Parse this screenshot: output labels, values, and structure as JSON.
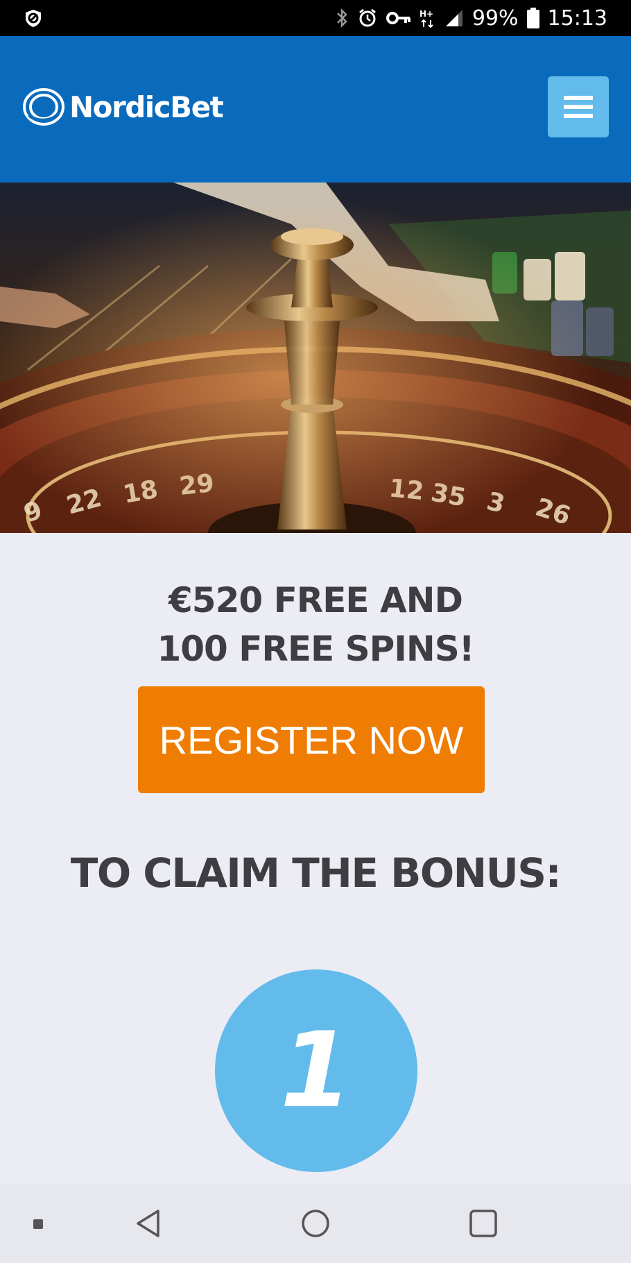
{
  "status_bar": {
    "battery": "99%",
    "time": "15:13",
    "icons": [
      "shield-icon",
      "bluetooth-icon",
      "alarm-icon",
      "vpn-key-icon",
      "data-icon",
      "signal-icon",
      "battery-icon"
    ]
  },
  "header": {
    "brand": "NordicBet",
    "menu_icon": "hamburger-icon",
    "brand_color": "#0a6bbd",
    "accent_color": "#62bbea"
  },
  "hero": {
    "image": "roulette-wheel-photo"
  },
  "promo": {
    "line1": "€520 FREE AND",
    "line2": "100 FREE SPINS!",
    "cta_label": "REGISTER NOW",
    "cta_color": "#ef7d04"
  },
  "claim": {
    "heading": "TO CLAIM THE BONUS:",
    "step_number": "1"
  },
  "nav_bar": {
    "items": [
      "dot-icon",
      "back-icon",
      "home-icon",
      "recents-icon"
    ]
  }
}
